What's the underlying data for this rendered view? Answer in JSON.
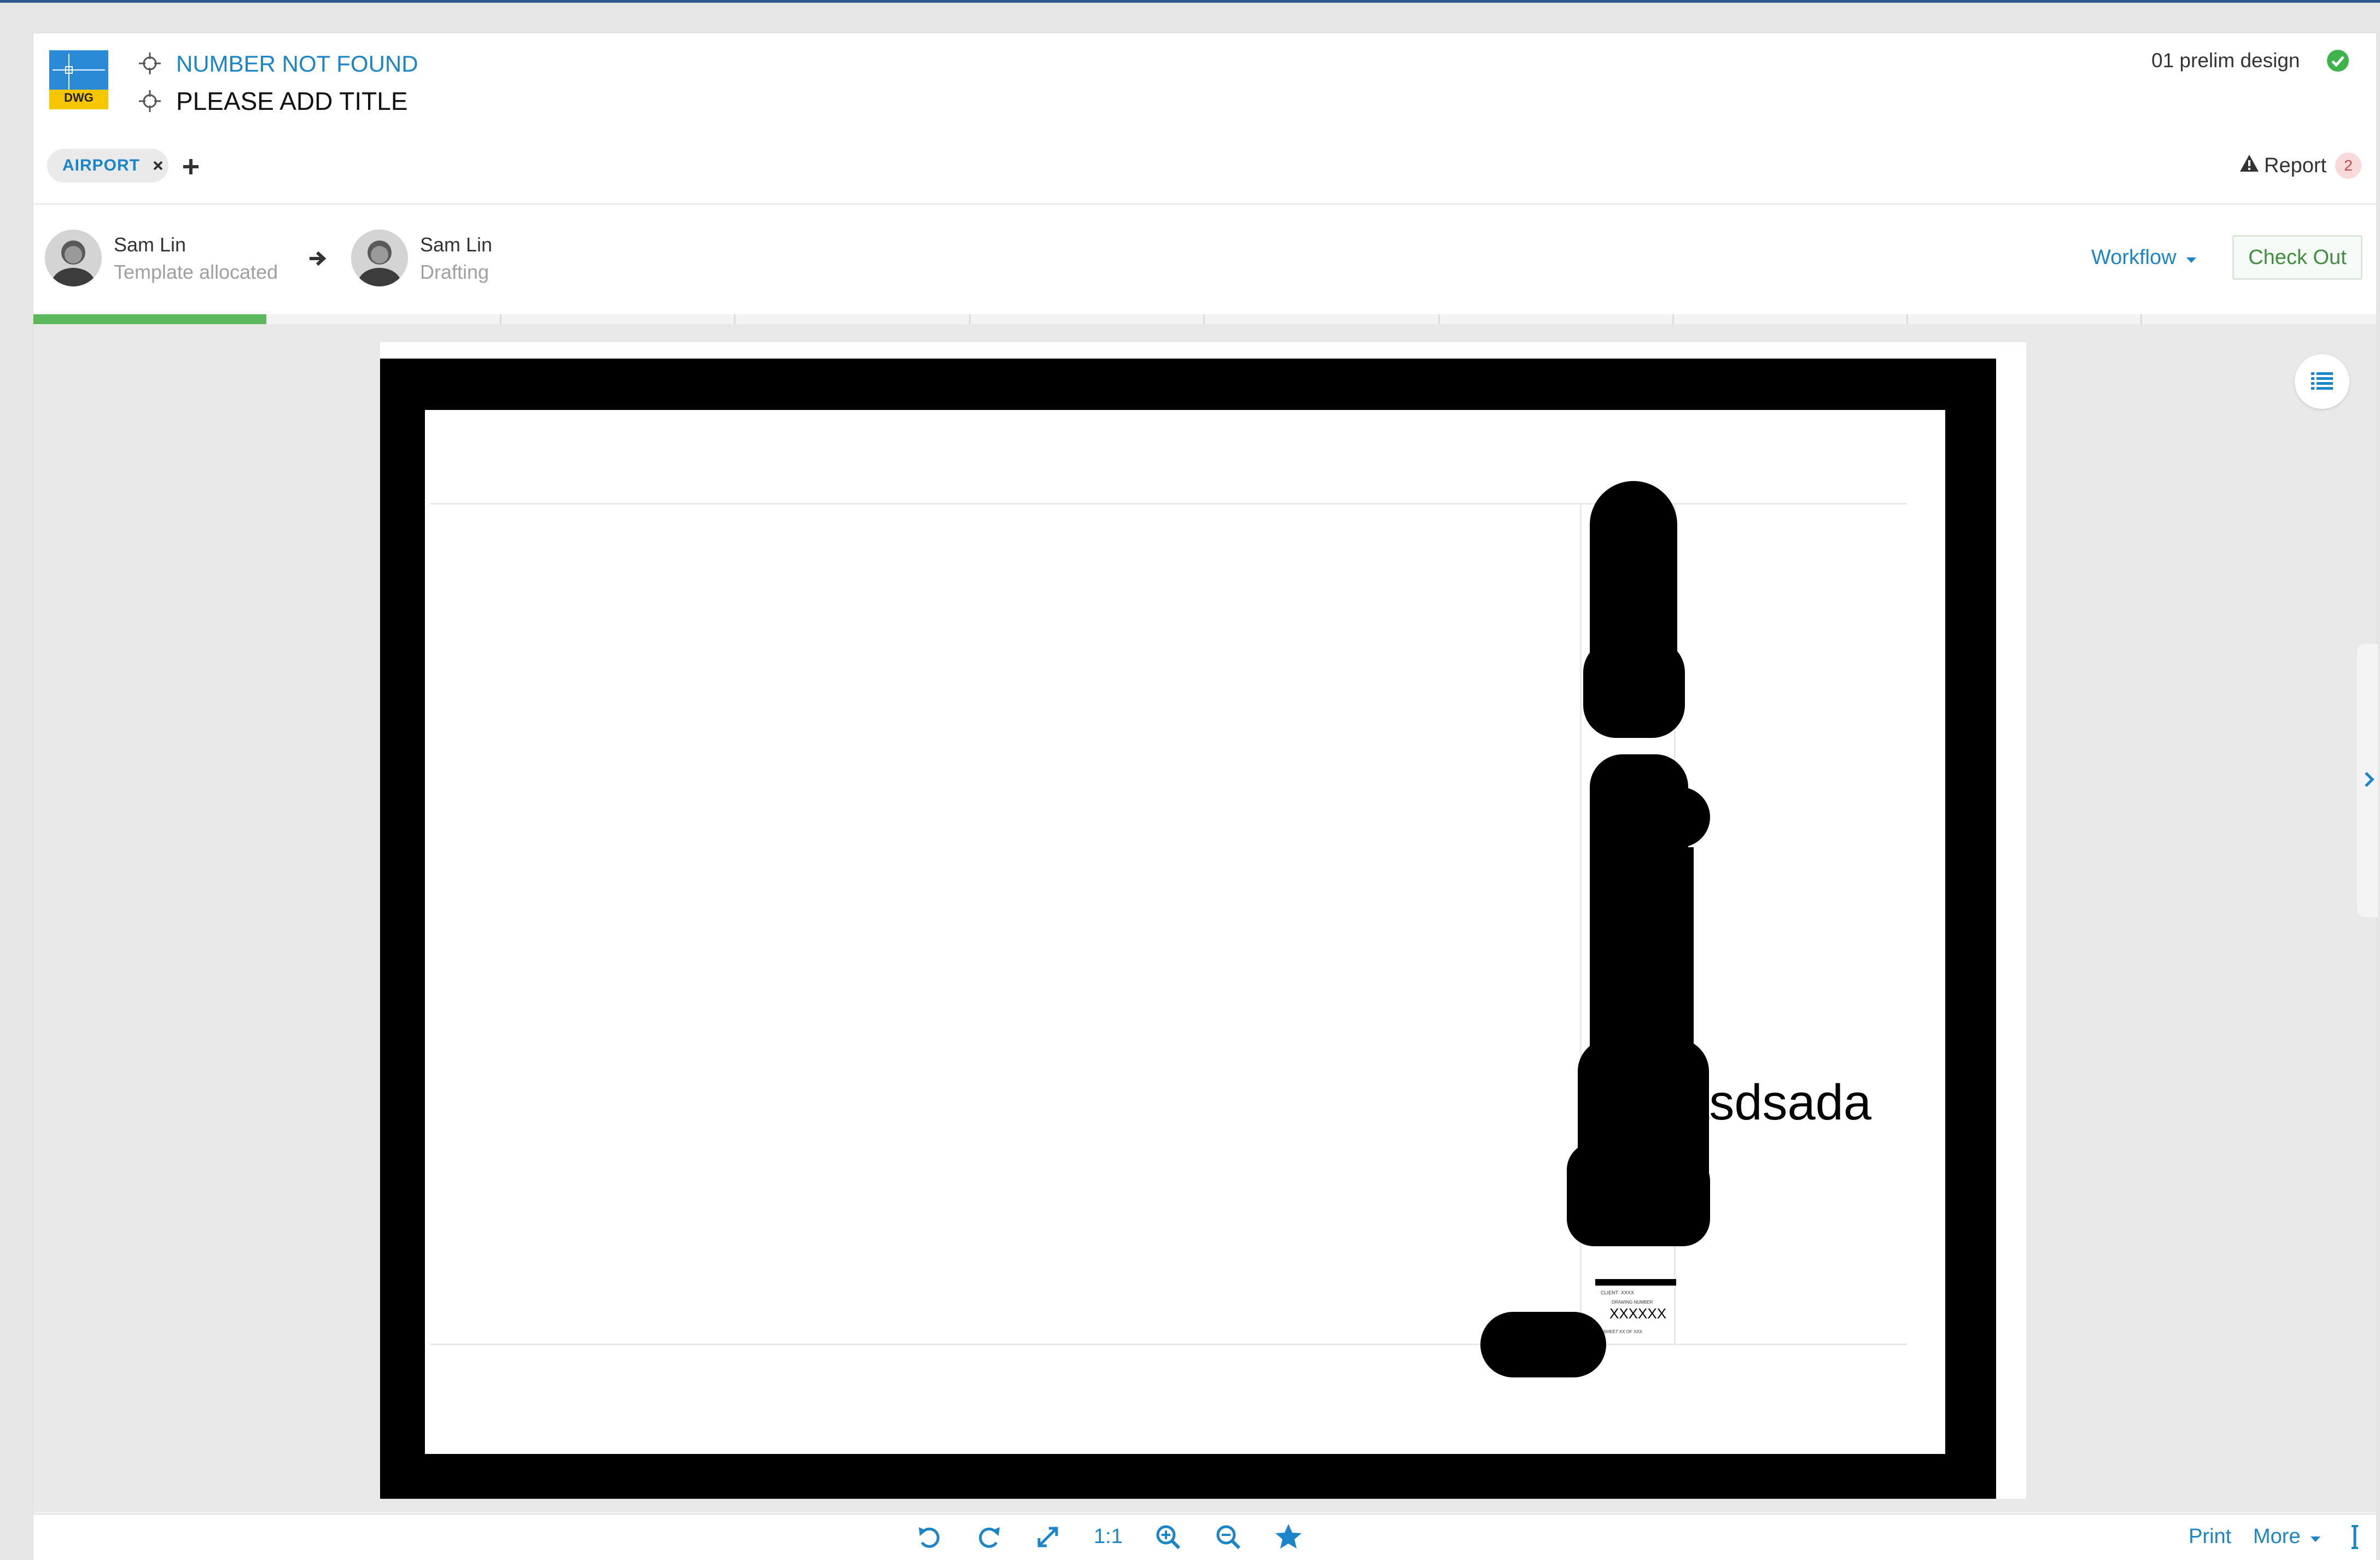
{
  "header": {
    "file_type_badge": "DWG",
    "doc_number": "NUMBER NOT FOUND",
    "doc_title": "PLEASE ADD TITLE",
    "status": "01 prelim design",
    "status_icon": "check-circle-icon"
  },
  "tags": {
    "items": [
      {
        "label": "AIRPORT"
      }
    ],
    "add_icon": "plus-icon"
  },
  "report": {
    "label": "Report",
    "count": "2"
  },
  "workflow_bar": {
    "from": {
      "name": "Sam Lin",
      "status": "Template allocated"
    },
    "to": {
      "name": "Sam Lin",
      "status": "Drafting"
    },
    "workflow_label": "Workflow",
    "checkout_label": "Check Out",
    "progress": {
      "segments": 10,
      "completed": 1
    }
  },
  "drawing": {
    "overflow_text": "sdasdsada",
    "title_block": {
      "client_label": "CLIENT",
      "client_value": "XXXX",
      "drawing_number_label": "DRAWING NUMBER",
      "drawing_number": "XXXXXX",
      "sheet_text": "SHEET  XX  OF  XXX"
    }
  },
  "toolbar": {
    "zoom_label": "1:1",
    "print_label": "Print",
    "more_label": "More"
  },
  "colors": {
    "accent": "#1a86c9",
    "success": "#3cb44a",
    "progress": "#5cb85c"
  }
}
